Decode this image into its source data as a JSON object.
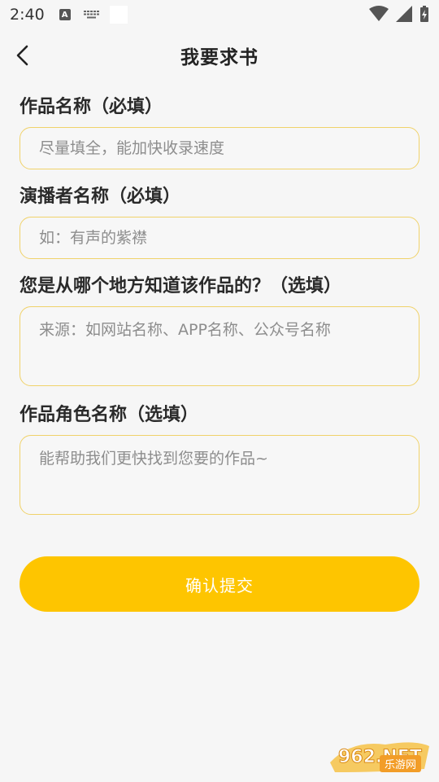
{
  "status_bar": {
    "time": "2:40",
    "a_badge": "A"
  },
  "header": {
    "title": "我要求书"
  },
  "form": {
    "fields": [
      {
        "label": "作品名称（必填）",
        "placeholder": "尽量填全，能加快收录速度"
      },
      {
        "label": "演播者名称（必填）",
        "placeholder": "如：有声的紫襟"
      },
      {
        "label": "您是从哪个地方知道该作品的？（选填）",
        "placeholder": "来源：如网站名称、APP名称、公众号名称"
      },
      {
        "label": "作品角色名称（选填）",
        "placeholder": "能帮助我们更快找到您要的作品~"
      }
    ],
    "submit_label": "确认提交"
  },
  "watermark": {
    "logo_text": "962.NET",
    "sub_text": "乐游网"
  },
  "colors": {
    "accent": "#fec500",
    "field_border": "#f0d26a",
    "background": "#f6f6f6"
  }
}
